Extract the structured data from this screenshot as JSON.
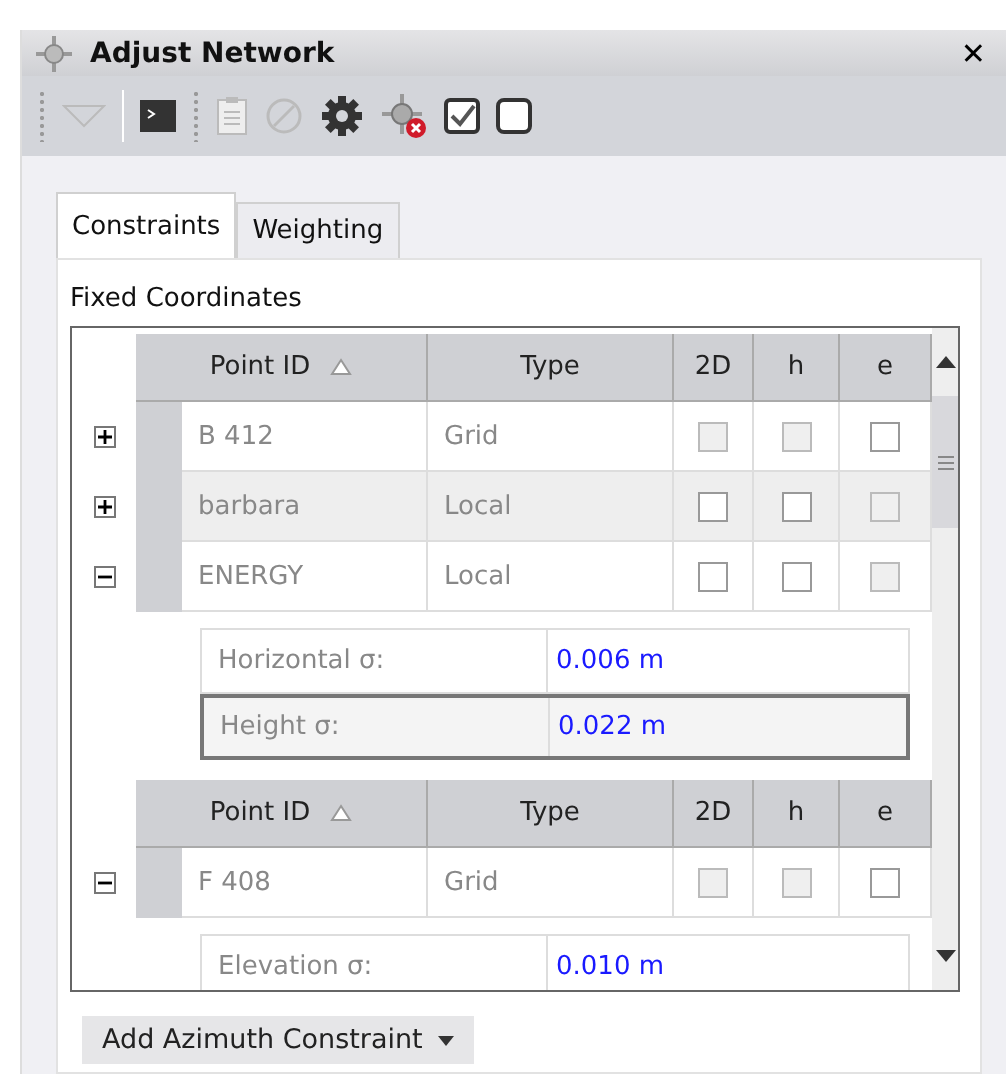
{
  "window": {
    "title": "Adjust Network",
    "close": "✕"
  },
  "toolbar": [
    {
      "kind": "grip"
    },
    {
      "kind": "dropdown",
      "disabled": true
    },
    {
      "kind": "separator"
    },
    {
      "kind": "terminal",
      "disabled": false
    },
    {
      "kind": "grip"
    },
    {
      "kind": "clipboard",
      "disabled": true
    },
    {
      "kind": "cancel",
      "disabled": true
    },
    {
      "kind": "gear",
      "disabled": false
    },
    {
      "kind": "node-remove",
      "disabled": false
    },
    {
      "kind": "check-all",
      "disabled": false
    },
    {
      "kind": "uncheck-all",
      "disabled": false
    }
  ],
  "tabs": [
    {
      "label": "Constraints",
      "selected": true
    },
    {
      "label": "Weighting",
      "selected": false
    }
  ],
  "section_title": "Fixed Coordinates",
  "bands": [
    {
      "columns": [
        "Point ID",
        "Type",
        "2D",
        "h",
        "e"
      ],
      "rows": [
        {
          "point_id": "B 412",
          "type": "Grid",
          "expanded": false,
          "checks": [
            {
              "checked": false,
              "disabled": true
            },
            {
              "checked": false,
              "disabled": true
            },
            {
              "checked": false,
              "disabled": false
            }
          ]
        },
        {
          "point_id": "barbara",
          "type": "Local",
          "expanded": false,
          "checks": [
            {
              "checked": false,
              "disabled": false
            },
            {
              "checked": false,
              "disabled": false
            },
            {
              "checked": false,
              "disabled": true
            }
          ]
        },
        {
          "point_id": "ENERGY",
          "type": "Local",
          "expanded": true,
          "checks": [
            {
              "checked": false,
              "disabled": false
            },
            {
              "checked": false,
              "disabled": false
            },
            {
              "checked": false,
              "disabled": true
            }
          ],
          "details": [
            {
              "label": "Horizontal σ:",
              "value": "0.006 m",
              "selected": false
            },
            {
              "label": "Height σ:",
              "value": "0.022 m",
              "selected": true
            }
          ]
        }
      ]
    },
    {
      "columns": [
        "Point ID",
        "Type",
        "2D",
        "h",
        "e"
      ],
      "rows": [
        {
          "point_id": "F 408",
          "type": "Grid",
          "expanded": true,
          "checks": [
            {
              "checked": false,
              "disabled": true
            },
            {
              "checked": false,
              "disabled": true
            },
            {
              "checked": false,
              "disabled": false
            }
          ],
          "details": [
            {
              "label": "Elevation σ:",
              "value": "0.010 m",
              "selected": false
            }
          ]
        }
      ]
    }
  ],
  "add_button": {
    "label": "Add Azimuth Constraint"
  }
}
